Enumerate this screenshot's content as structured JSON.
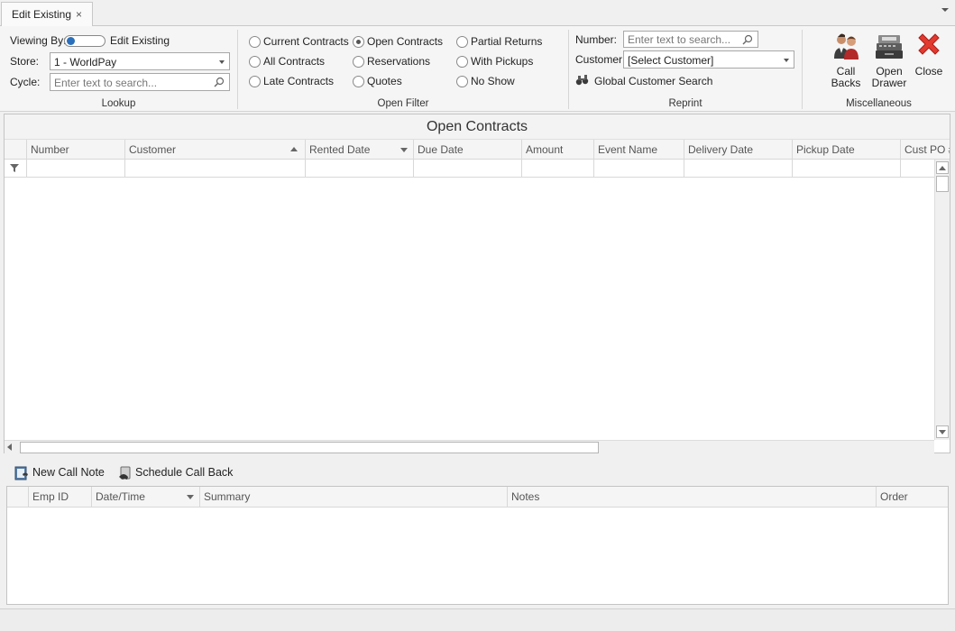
{
  "tab": {
    "label": "Edit Existing",
    "close": "×"
  },
  "lookup": {
    "group_label": "Lookup",
    "viewing_by_label": "Viewing By:",
    "viewing_by_value": "Edit Existing",
    "store_label": "Store:",
    "store_value": "1 - WorldPay",
    "cycle_label": "Cycle:",
    "cycle_placeholder": "Enter text to search..."
  },
  "open_filter": {
    "group_label": "Open Filter",
    "options": [
      {
        "label": "Current Contracts",
        "selected": false
      },
      {
        "label": "All Contracts",
        "selected": false
      },
      {
        "label": "Late Contracts",
        "selected": false
      },
      {
        "label": "Open Contracts",
        "selected": true
      },
      {
        "label": "Reservations",
        "selected": false
      },
      {
        "label": "Quotes",
        "selected": false
      },
      {
        "label": "Partial Returns",
        "selected": false
      },
      {
        "label": "With Pickups",
        "selected": false
      },
      {
        "label": "No Show",
        "selected": false
      }
    ]
  },
  "reprint": {
    "group_label": "Reprint",
    "number_label": "Number:",
    "number_placeholder": "Enter text to search...",
    "customer_label": "Customer:",
    "customer_value": "[Select Customer]",
    "global_search_label": "Global Customer Search"
  },
  "misc": {
    "group_label": "Miscellaneous",
    "call_backs": "Call Backs",
    "open_drawer_line1": "Open",
    "open_drawer_line2": "Drawer",
    "close": "Close"
  },
  "grid": {
    "title": "Open Contracts",
    "columns": [
      "Number",
      "Customer",
      "Rented Date",
      "Due Date",
      "Amount",
      "Event Name",
      "Delivery Date",
      "Pickup Date",
      "Cust PO #"
    ]
  },
  "notes": {
    "new_call_note": "New Call Note",
    "schedule_call_back": "Schedule Call Back",
    "columns": [
      "Emp ID",
      "Date/Time",
      "Summary",
      "Notes",
      "Order"
    ]
  }
}
